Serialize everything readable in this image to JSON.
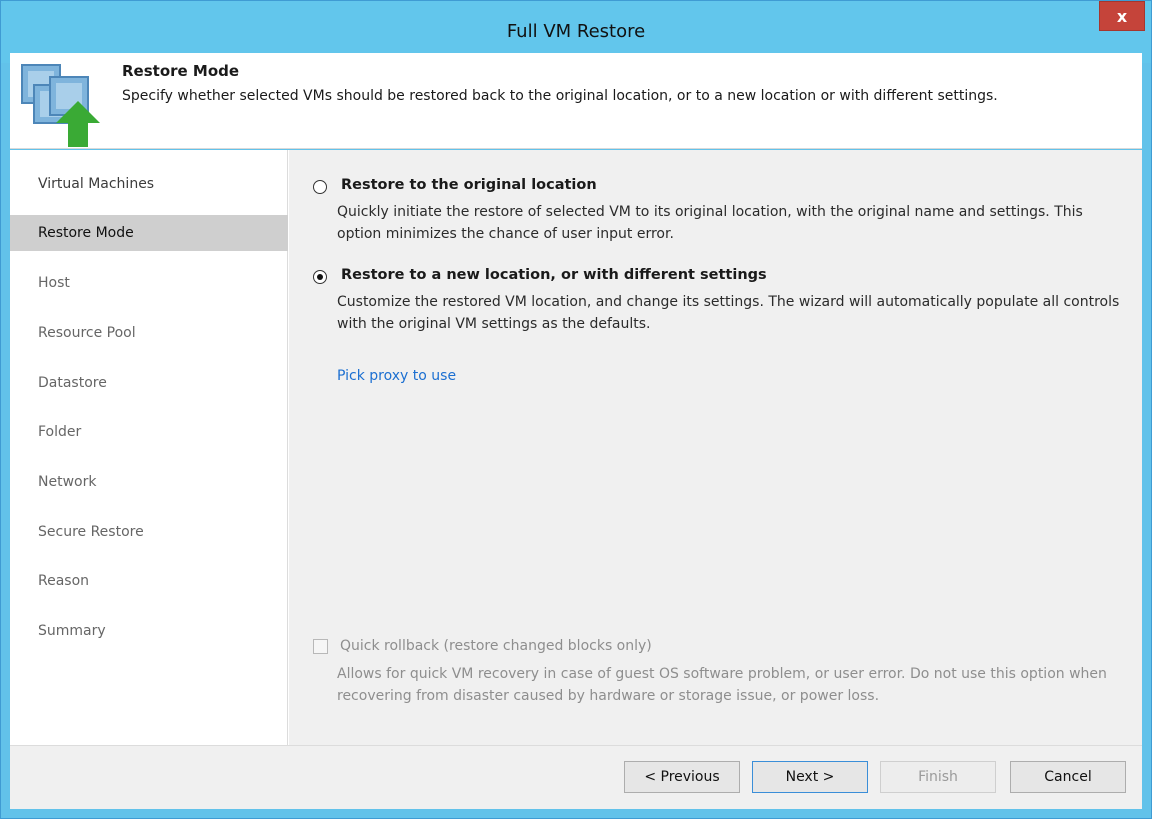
{
  "window": {
    "title": "Full VM Restore",
    "close_label": "x"
  },
  "header": {
    "title": "Restore Mode",
    "description": "Specify whether selected VMs should be restored back to the original location, or to a new location or with different settings.",
    "icon": "vm-restore-icon"
  },
  "sidebar": {
    "items": [
      {
        "label": "Virtual Machines",
        "state": "done"
      },
      {
        "label": "Restore Mode",
        "state": "active"
      },
      {
        "label": "Host",
        "state": "future"
      },
      {
        "label": "Resource Pool",
        "state": "future"
      },
      {
        "label": "Datastore",
        "state": "future"
      },
      {
        "label": "Folder",
        "state": "future"
      },
      {
        "label": "Network",
        "state": "future"
      },
      {
        "label": "Secure Restore",
        "state": "future"
      },
      {
        "label": "Reason",
        "state": "future"
      },
      {
        "label": "Summary",
        "state": "future"
      }
    ]
  },
  "options": [
    {
      "title": "Restore to the original location",
      "description": "Quickly initiate the restore of selected VM to its original location, with the original name and settings. This option minimizes the chance of user input error.",
      "selected": false
    },
    {
      "title": "Restore to a new location, or with different settings",
      "description": "Customize the restored VM location, and change its settings. The wizard will automatically populate all controls with the original VM settings as the defaults.",
      "selected": true
    }
  ],
  "proxy_link": "Pick proxy to use",
  "quick_rollback": {
    "label": "Quick rollback (restore changed blocks only)",
    "description": "Allows for quick VM recovery in case of guest OS software problem, or user error. Do not use this option when recovering from disaster caused by hardware or storage issue, or power loss.",
    "checked": false,
    "enabled": false
  },
  "buttons": {
    "previous": "< Previous",
    "next": "Next >",
    "finish": "Finish",
    "cancel": "Cancel"
  },
  "colors": {
    "titlebar": "#62c6ec",
    "close": "#c5443a",
    "link": "#1b6fd1",
    "active_nav": "#cfcfcf"
  }
}
